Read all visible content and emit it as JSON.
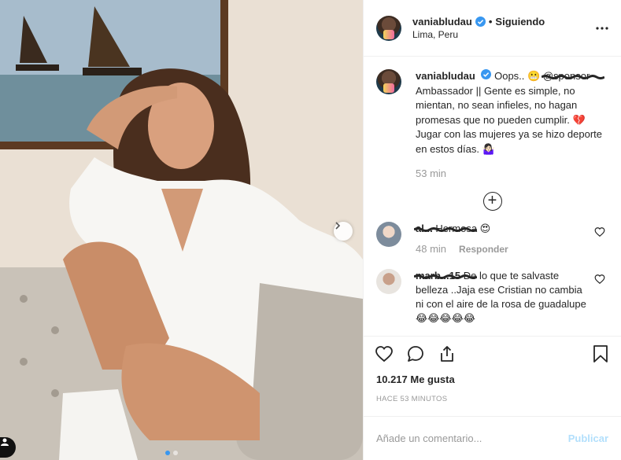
{
  "post": {
    "username": "vaniabludau",
    "follow_status": "Siguiendo",
    "location": "Lima, Peru",
    "verified": true
  },
  "caption": {
    "username": "vaniabludau",
    "text_before": "Oops.. 😬",
    "redacted_word": "@sponsor",
    "text_after": " Ambassador || Gente es simple, no mientan, no sean infieles, no hagan promesas que no pueden cumplir. 💔 Jugar con las mujeres ya se hizo deporte en estos días. 🤷🏻‍♀️",
    "time": "53 min"
  },
  "load_more_label": "+",
  "comments": [
    {
      "username_redacted": "al...",
      "text": "Hermosa 😍",
      "time": "48 min",
      "reply_label": "Responder"
    },
    {
      "username_redacted": "marb...15",
      "text": "De lo que te salvaste belleza ..Jaja ese Cristian no cambia ni con el aire de la rosa de guadalupe 😂😂😂😂😂"
    }
  ],
  "likes": "10.217 Me gusta",
  "posted_ago": "Hace 53 minutos",
  "comment_box": {
    "placeholder": "Añade un comentario...",
    "publish_label": "Publicar"
  },
  "colors": {
    "text": "#262626",
    "muted": "#999999",
    "border": "#efefef",
    "verified_blue": "#3897f0",
    "publish_disabled": "#b2dffc"
  },
  "icons": {
    "more": "more-horizontal-icon",
    "like": "heart-icon",
    "comment": "comment-bubble-icon",
    "share": "share-icon",
    "save": "bookmark-icon",
    "carousel_next": "chevron-right-icon"
  },
  "carousel": {
    "current": 1,
    "total": 2
  }
}
